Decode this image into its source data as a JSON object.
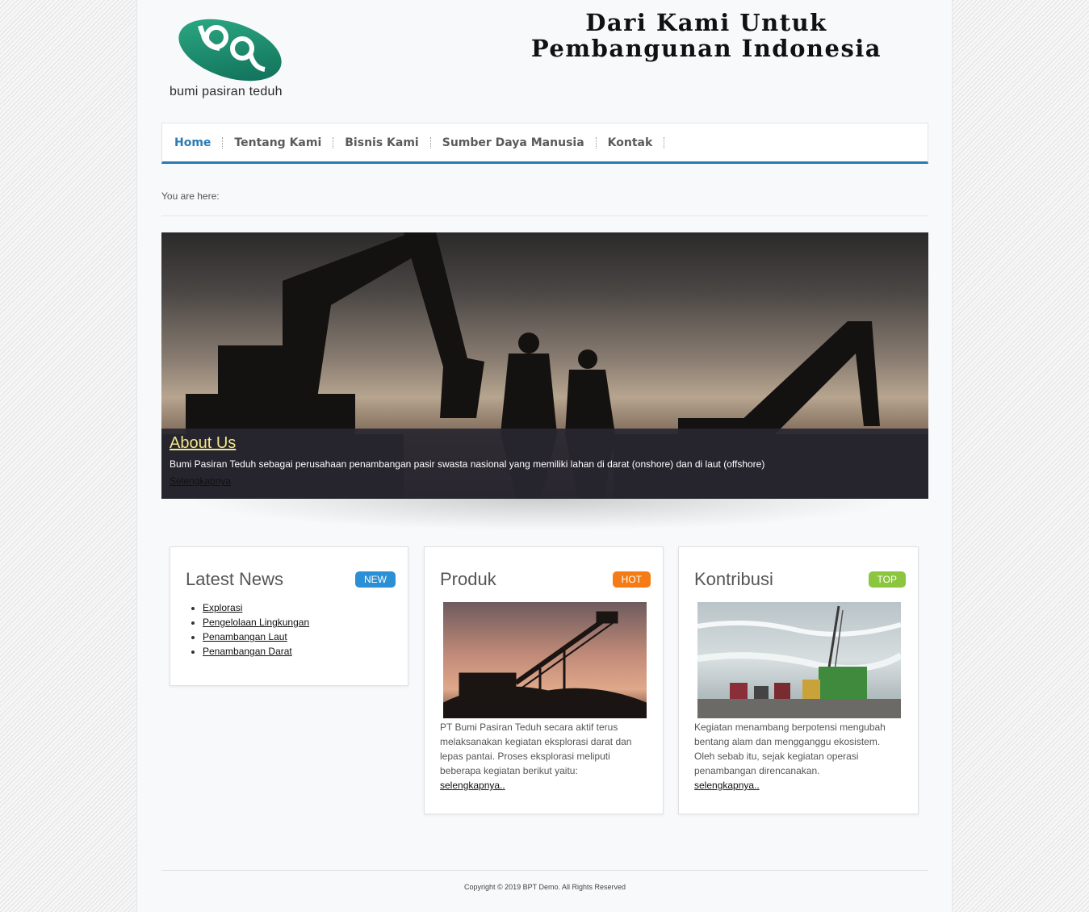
{
  "header": {
    "logo_text": "bumi pasiran teduh",
    "tagline_line1": "Dari Kami Untuk",
    "tagline_line2": "Pembangunan Indonesia"
  },
  "nav": {
    "items": [
      {
        "label": "Home",
        "active": true
      },
      {
        "label": "Tentang Kami"
      },
      {
        "label": "Bisnis Kami"
      },
      {
        "label": "Sumber Daya Manusia"
      },
      {
        "label": "Kontak"
      }
    ]
  },
  "breadcrumb": {
    "label": "You are here:"
  },
  "slider": {
    "title": "About Us",
    "description": "Bumi Pasiran Teduh sebagai perusahaan penambangan pasir swasta nasional yang memiliki lahan di darat (onshore) dan di laut (offshore)",
    "more": "Selengkapnya"
  },
  "modules": {
    "news": {
      "title": "Latest News",
      "badge": "NEW",
      "badge_color": "#2a8fd4",
      "items": [
        "Explorasi",
        "Pengelolaan Lingkungan",
        "Penambangan Laut",
        "Penambangan Darat"
      ]
    },
    "produk": {
      "title": "Produk",
      "badge": "HOT",
      "badge_color": "#f47b16",
      "text": "PT Bumi Pasiran Teduh secara aktif terus melaksanakan kegiatan eksplorasi darat dan lepas pantai. Proses eksplorasi meliputi beberapa kegiatan berikut yaitu:",
      "more": "selengkapnya.."
    },
    "kontribusi": {
      "title": "Kontribusi",
      "badge": "TOP",
      "badge_color": "#8cc63f",
      "text": "Kegiatan menambang berpotensi mengubah bentang alam dan mengganggu ekosistem. Oleh sebab itu, sejak kegiatan operasi penambangan direncanakan.",
      "more": "selengkapnya.."
    }
  },
  "footer": {
    "copyright": "Copyright © 2019 BPT Demo. All Rights Reserved"
  },
  "colors": {
    "nav_accent": "#2a7ab5",
    "caption_title": "#f2e68a"
  }
}
